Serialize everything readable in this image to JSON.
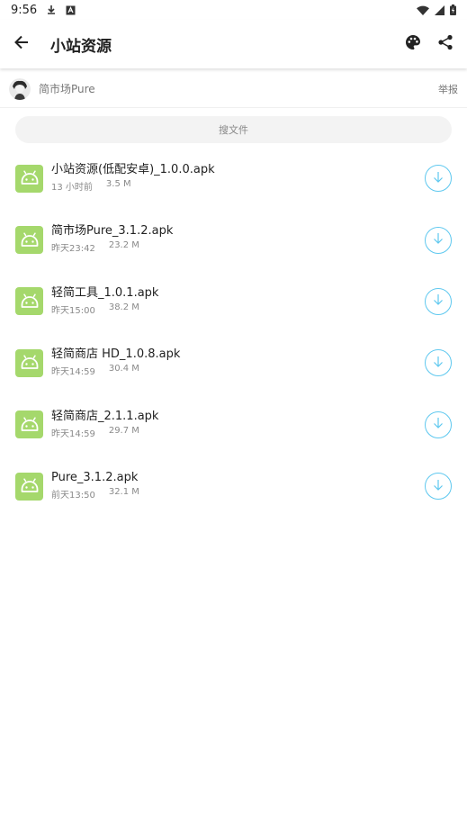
{
  "status_bar": {
    "time": "9:56",
    "icons": [
      "download-icon",
      "notification-a-icon",
      "wifi-icon",
      "signal-icon",
      "battery-icon"
    ]
  },
  "app_bar": {
    "title": "小站资源",
    "icons": [
      "back-arrow-icon",
      "palette-icon",
      "share-icon"
    ]
  },
  "owner": {
    "name": "简市场Pure",
    "report_label": "举报"
  },
  "search": {
    "placeholder": "搜文件"
  },
  "files": [
    {
      "name": "小站资源(低配安卓)_1.0.0.apk",
      "time": "13 小时前",
      "size": "3.5 M"
    },
    {
      "name": "简市场Pure_3.1.2.apk",
      "time": "昨天23:42",
      "size": "23.2 M"
    },
    {
      "name": "轻简工具_1.0.1.apk",
      "time": "昨天15:00",
      "size": "38.2 M"
    },
    {
      "name": "轻简商店 HD_1.0.8.apk",
      "time": "昨天14:59",
      "size": "30.4 M"
    },
    {
      "name": "轻简商店_2.1.1.apk",
      "time": "昨天14:59",
      "size": "29.7 M"
    },
    {
      "name": "Pure_3.1.2.apk",
      "time": "前天13:50",
      "size": "32.1 M"
    }
  ],
  "colors": {
    "apk_icon_bg": "#a5d86c",
    "download_accent": "#5ec8ef"
  }
}
